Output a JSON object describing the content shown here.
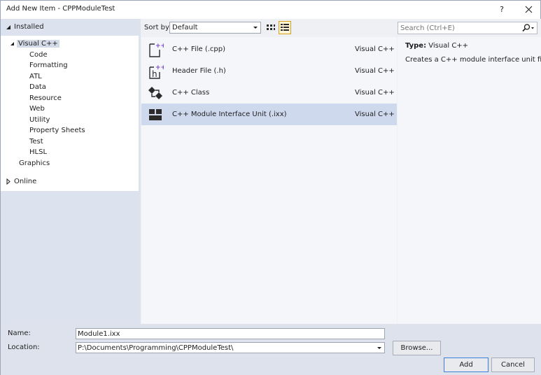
{
  "window": {
    "title": "Add New Item - CPPModuleTest",
    "help_label": "?"
  },
  "left": {
    "installed_label": "Installed",
    "online_label": "Online",
    "tree": {
      "root": "Visual C++",
      "children": [
        "Code",
        "Formatting",
        "ATL",
        "Data",
        "Resource",
        "Web",
        "Utility",
        "Property Sheets",
        "Test",
        "HLSL"
      ],
      "sibling": "Graphics"
    }
  },
  "toolbar": {
    "sort_label": "Sort by:",
    "sort_value": "Default"
  },
  "search": {
    "placeholder": "Search (Ctrl+E)"
  },
  "templates": [
    {
      "name": "C++ File (.cpp)",
      "lang": "Visual C++",
      "icon": "cpp-file-icon"
    },
    {
      "name": "Header File (.h)",
      "lang": "Visual C++",
      "icon": "header-file-icon"
    },
    {
      "name": "C++ Class",
      "lang": "Visual C++",
      "icon": "cpp-class-icon"
    },
    {
      "name": "C++ Module Interface Unit (.ixx)",
      "lang": "Visual C++",
      "icon": "module-interface-icon",
      "selected": true
    }
  ],
  "details": {
    "type_label": "Type:",
    "type_value": "Visual C++",
    "description": "Creates a C++ module interface unit file"
  },
  "form": {
    "name_label": "Name:",
    "name_value": "Module1.ixx",
    "location_label": "Location:",
    "location_value": "P:\\Documents\\Programming\\CPPModuleTest\\",
    "browse_label": "Browse...",
    "add_label": "Add",
    "cancel_label": "Cancel"
  },
  "colors": {
    "selection": "#cfd9ee",
    "accent": "#3c7fd8",
    "icon_purple": "#7b45c8",
    "icon_dark": "#2b2b2b"
  }
}
